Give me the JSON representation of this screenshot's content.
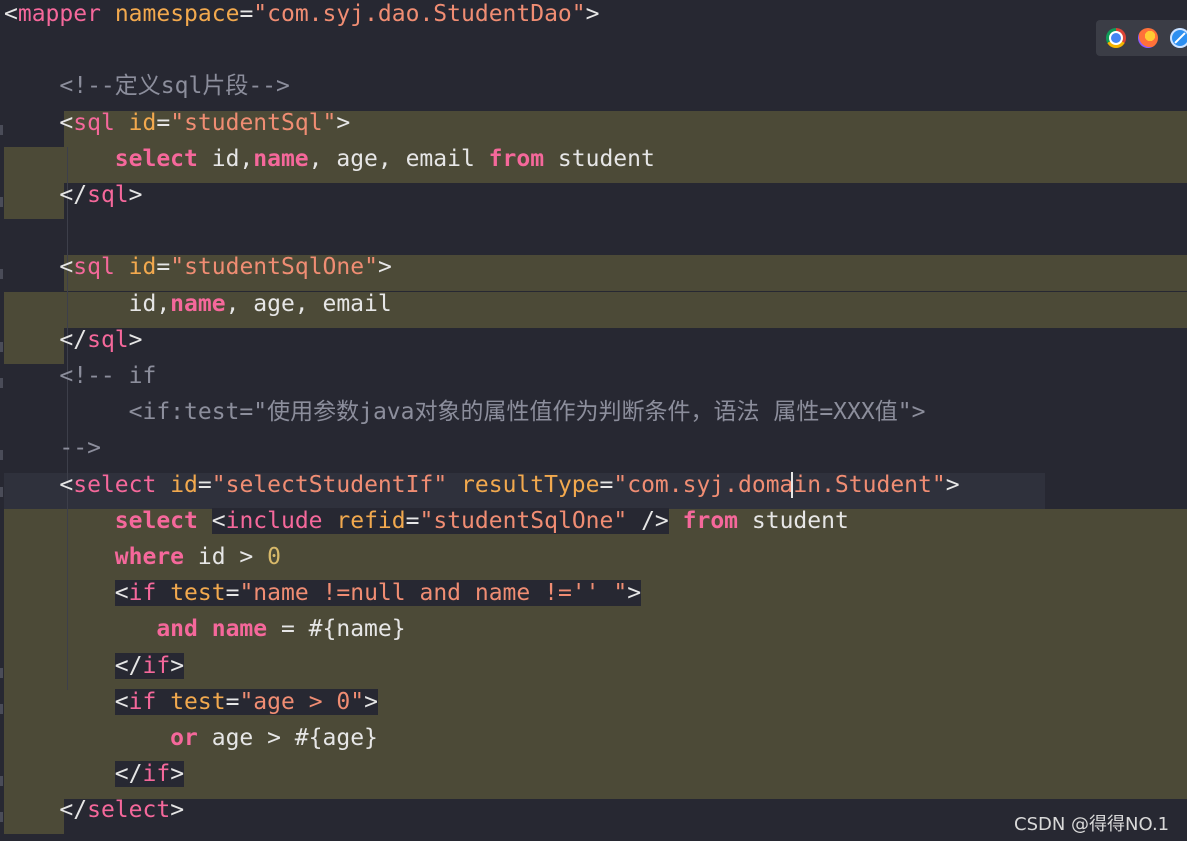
{
  "editor": {
    "lines": [
      [
        [
          "br",
          "<"
        ],
        [
          "tag",
          "mapper"
        ],
        [
          "sp",
          " "
        ],
        [
          "attr",
          "namespace"
        ],
        [
          "br",
          "="
        ],
        [
          "str",
          "\"com.syj.dao.StudentDao\""
        ],
        [
          "br",
          ">"
        ]
      ],
      [],
      [
        [
          "sp",
          "    "
        ],
        [
          "cm",
          "<!--定义sql片段-->"
        ]
      ],
      [
        [
          "sp",
          "    "
        ],
        [
          "br",
          "<"
        ],
        [
          "tag",
          "sql"
        ],
        [
          "sp",
          " "
        ],
        [
          "attr",
          "id"
        ],
        [
          "br",
          "="
        ],
        [
          "str",
          "\"studentSql\""
        ],
        [
          "br",
          ">"
        ]
      ],
      [
        [
          "sp",
          "        "
        ],
        [
          "kw",
          "select"
        ],
        [
          "txt",
          " id,"
        ],
        [
          "kw",
          "name"
        ],
        [
          "txt",
          ", age, email "
        ],
        [
          "kw",
          "from"
        ],
        [
          "txt",
          " student"
        ]
      ],
      [
        [
          "sp",
          "    "
        ],
        [
          "br",
          "</"
        ],
        [
          "tag",
          "sql"
        ],
        [
          "br",
          ">"
        ]
      ],
      [],
      [
        [
          "sp",
          "    "
        ],
        [
          "br",
          "<"
        ],
        [
          "tag",
          "sql"
        ],
        [
          "sp",
          " "
        ],
        [
          "attr",
          "id"
        ],
        [
          "br",
          "="
        ],
        [
          "str",
          "\"studentSqlOne\""
        ],
        [
          "br",
          ">"
        ]
      ],
      [
        [
          "sp",
          "         "
        ],
        [
          "txt",
          "id,"
        ],
        [
          "kw",
          "name"
        ],
        [
          "txt",
          ", age, email"
        ]
      ],
      [
        [
          "sp",
          "    "
        ],
        [
          "br",
          "</"
        ],
        [
          "tag",
          "sql"
        ],
        [
          "br",
          ">"
        ]
      ],
      [
        [
          "sp",
          "    "
        ],
        [
          "cm",
          "<!-- if"
        ]
      ],
      [
        [
          "sp",
          "         "
        ],
        [
          "cm",
          "<if:test=\"使用参数java对象的属性值作为判断条件，语法 属性=XXX值\">"
        ]
      ],
      [
        [
          "sp",
          "    "
        ],
        [
          "cm",
          "-->"
        ]
      ],
      [
        [
          "sp",
          "    "
        ],
        [
          "br",
          "<"
        ],
        [
          "tag",
          "select"
        ],
        [
          "sp",
          " "
        ],
        [
          "attr",
          "id"
        ],
        [
          "br",
          "="
        ],
        [
          "str",
          "\"selectStudentIf\""
        ],
        [
          "sp",
          " "
        ],
        [
          "attr",
          "resultType"
        ],
        [
          "br",
          "="
        ],
        [
          "str",
          "\"com.syj.domain.Student\""
        ],
        [
          "br",
          ">"
        ]
      ],
      [
        [
          "sp",
          "        "
        ],
        [
          "kw",
          "select"
        ],
        [
          "sp",
          " "
        ],
        [
          "br",
          "<"
        ],
        [
          "tag",
          "include"
        ],
        [
          "sp",
          " "
        ],
        [
          "attr",
          "refid"
        ],
        [
          "br",
          "="
        ],
        [
          "str",
          "\"studentSqlOne\""
        ],
        [
          "sp",
          " "
        ],
        [
          "br",
          "/>"
        ],
        [
          "sp",
          " "
        ],
        [
          "kw",
          "from"
        ],
        [
          "txt",
          " student"
        ]
      ],
      [
        [
          "sp",
          "        "
        ],
        [
          "kw",
          "where"
        ],
        [
          "txt",
          " id > "
        ],
        [
          "num",
          "0"
        ]
      ],
      [
        [
          "sp",
          "        "
        ],
        [
          "br",
          "<"
        ],
        [
          "tag",
          "if"
        ],
        [
          "sp",
          " "
        ],
        [
          "attr",
          "test"
        ],
        [
          "br",
          "="
        ],
        [
          "str",
          "\"name !=null and name !='' \""
        ],
        [
          "br",
          ">"
        ]
      ],
      [
        [
          "sp",
          "           "
        ],
        [
          "kw",
          "and"
        ],
        [
          "sp",
          " "
        ],
        [
          "kw",
          "name"
        ],
        [
          "txt",
          " = #{name}"
        ]
      ],
      [
        [
          "sp",
          "        "
        ],
        [
          "br",
          "</"
        ],
        [
          "tag",
          "if"
        ],
        [
          "br",
          ">"
        ]
      ],
      [
        [
          "sp",
          "        "
        ],
        [
          "br",
          "<"
        ],
        [
          "tag",
          "if"
        ],
        [
          "sp",
          " "
        ],
        [
          "attr",
          "test"
        ],
        [
          "br",
          "="
        ],
        [
          "str",
          "\"age > 0\""
        ],
        [
          "br",
          ">"
        ]
      ],
      [
        [
          "sp",
          "            "
        ],
        [
          "kw",
          "or"
        ],
        [
          "txt",
          " age > #{age}"
        ]
      ],
      [
        [
          "sp",
          "        "
        ],
        [
          "br",
          "</"
        ],
        [
          "tag",
          "if"
        ],
        [
          "br",
          ">"
        ]
      ],
      [
        [
          "sp",
          "    "
        ],
        [
          "br",
          "</"
        ],
        [
          "tag",
          "select"
        ],
        [
          "br",
          ">"
        ]
      ]
    ]
  },
  "browser_icons": [
    "chrome-icon",
    "firefox-icon",
    "safari-icon"
  ],
  "watermark": "CSDN @得得NO.1",
  "colors": {
    "background": "#272832",
    "highlight": "#4c4a37",
    "tag": "#f5689b",
    "attribute": "#f2a94e",
    "string": "#f08d73",
    "comment": "#8c8e9c",
    "text": "#e6e6e6"
  }
}
